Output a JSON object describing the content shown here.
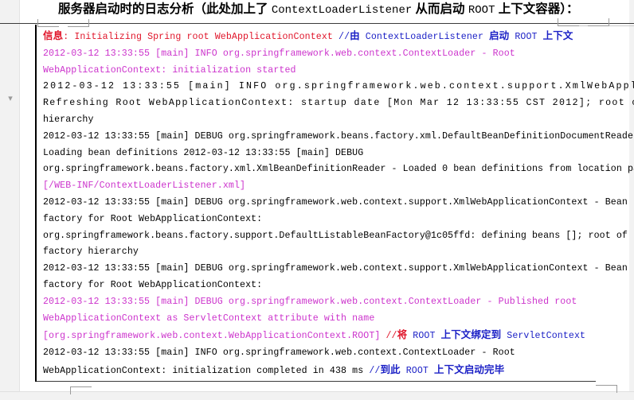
{
  "document": {
    "title_parts": [
      {
        "text": "服务器启动时的日志分析（此处加上了 ",
        "style": "cjk"
      },
      {
        "text": "ContextLoaderListener",
        "style": "mono"
      },
      {
        "text": " 从而启动 ",
        "style": "cjk"
      },
      {
        "text": "ROOT",
        "style": "mono"
      },
      {
        "text": " 上下文容器）：",
        "style": "cjk"
      }
    ],
    "title_plain": "服务器启动时的日志分析（此处加上了 ContextLoaderListener 从而启动 ROOT 上下文容器）："
  },
  "colors": {
    "red": "#e0152a",
    "pink": "#cc33cc",
    "black": "#000000",
    "blue": "#1c21c6",
    "page_background": "#ffffff",
    "chrome_background": "#f2f2f2",
    "border": "#000000"
  },
  "gutter": {
    "arrow_glyph": "▾"
  },
  "log": {
    "lines": [
      {
        "id": "line-1",
        "stretch": "",
        "runs": [
          {
            "text": "信息",
            "color": "red",
            "cjk": true
          },
          {
            "text": ": Initializing Spring root WebApplicationContext ",
            "color": "red"
          },
          {
            "text": "//",
            "color": "blue"
          },
          {
            "text": "由",
            "color": "blue",
            "cjk": true
          },
          {
            "text": " ContextLoaderListener ",
            "color": "blue"
          },
          {
            "text": "启动",
            "color": "blue",
            "cjk": true
          },
          {
            "text": " ROOT ",
            "color": "blue"
          },
          {
            "text": "上下文",
            "color": "blue",
            "cjk": true
          }
        ]
      },
      {
        "id": "line-2",
        "stretch": "",
        "runs": [
          {
            "text": "2012-03-12 13:33:55 [main] INFO org.springframework.web.context.ContextLoader - Root",
            "color": "pink"
          }
        ]
      },
      {
        "id": "line-3",
        "stretch": "",
        "runs": [
          {
            "text": "WebApplicationContext: initialization started",
            "color": "pink"
          }
        ]
      },
      {
        "id": "line-4",
        "stretch": "stretch-1",
        "runs": [
          {
            "text": "2012-03-12 13:33:55 [main] INFO org.springframework.web.context.support.XmlWebApplicationContext -",
            "color": "black"
          }
        ]
      },
      {
        "id": "line-5",
        "stretch": "stretch-2",
        "runs": [
          {
            "text": "Refreshing Root WebApplicationContext: startup date [Mon Mar 12 13:33:55 CST 2012]; root of context",
            "color": "black"
          }
        ]
      },
      {
        "id": "line-6",
        "stretch": "",
        "runs": [
          {
            "text": "hierarchy",
            "color": "black"
          }
        ]
      },
      {
        "id": "line-7",
        "stretch": "",
        "runs": [
          {
            "text": "2012-03-12 13:33:55 [main] DEBUG org.springframework.beans.factory.xml.DefaultBeanDefinitionDocumentReader -",
            "color": "black"
          }
        ]
      },
      {
        "id": "line-8",
        "stretch": "",
        "runs": [
          {
            "text": "Loading bean definitions 2012-03-12 13:33:55 [main] DEBUG",
            "color": "black"
          }
        ]
      },
      {
        "id": "line-9",
        "stretch": "",
        "runs": [
          {
            "text": "org.springframework.beans.factory.xml.XmlBeanDefinitionReader - Loaded 0 bean definitions from location pattern",
            "color": "black"
          }
        ]
      },
      {
        "id": "line-10",
        "stretch": "",
        "runs": [
          {
            "text": "[/WEB-INF/ContextLoaderListener.xml]",
            "color": "pink"
          }
        ]
      },
      {
        "id": "line-11",
        "stretch": "",
        "runs": [
          {
            "text": "2012-03-12 13:33:55 [main] DEBUG org.springframework.web.context.support.XmlWebApplicationContext - Bean",
            "color": "black"
          }
        ]
      },
      {
        "id": "line-12",
        "stretch": "",
        "runs": [
          {
            "text": "factory for Root WebApplicationContext:",
            "color": "black"
          }
        ]
      },
      {
        "id": "line-13",
        "stretch": "",
        "runs": [
          {
            "text": "org.springframework.beans.factory.support.DefaultListableBeanFactory@1c05ffd: defining beans []; root of",
            "color": "black"
          }
        ]
      },
      {
        "id": "line-14",
        "stretch": "",
        "runs": [
          {
            "text": "factory hierarchy",
            "color": "black"
          }
        ]
      },
      {
        "id": "line-15",
        "stretch": "",
        "runs": [
          {
            "text": "2012-03-12 13:33:55 [main] DEBUG org.springframework.web.context.support.XmlWebApplicationContext - Bean",
            "color": "black"
          }
        ]
      },
      {
        "id": "line-16",
        "stretch": "",
        "runs": [
          {
            "text": "factory for Root WebApplicationContext:",
            "color": "black"
          }
        ]
      },
      {
        "id": "line-17",
        "stretch": "",
        "runs": [
          {
            "text": "2012-03-12 13:33:55 [main] DEBUG org.springframework.web.context.ContextLoader - Published root",
            "color": "pink"
          }
        ]
      },
      {
        "id": "line-18",
        "stretch": "",
        "runs": [
          {
            "text": "WebApplicationContext as ServletContext attribute with name",
            "color": "pink"
          }
        ]
      },
      {
        "id": "line-19",
        "stretch": "",
        "runs": [
          {
            "text": "[org.springframework.web.context.WebApplicationContext.ROOT] ",
            "color": "pink"
          },
          {
            "text": "//",
            "color": "red"
          },
          {
            "text": "将",
            "color": "red",
            "cjk": true
          },
          {
            "text": " ROOT ",
            "color": "blue"
          },
          {
            "text": "上下文绑定到",
            "color": "blue",
            "cjk": true
          },
          {
            "text": " ServletContext",
            "color": "blue"
          }
        ]
      },
      {
        "id": "line-20",
        "stretch": "",
        "runs": [
          {
            "text": "2012-03-12 13:33:55 [main] INFO org.springframework.web.context.ContextLoader - Root",
            "color": "black"
          }
        ]
      },
      {
        "id": "line-21",
        "stretch": "",
        "runs": [
          {
            "text": "WebApplicationContext: initialization completed in 438 ms ",
            "color": "black"
          },
          {
            "text": "//",
            "color": "blue"
          },
          {
            "text": "到此",
            "color": "blue",
            "cjk": true
          },
          {
            "text": " ROOT ",
            "color": "blue"
          },
          {
            "text": "上下文启动完毕",
            "color": "blue",
            "cjk": true
          }
        ]
      }
    ]
  }
}
